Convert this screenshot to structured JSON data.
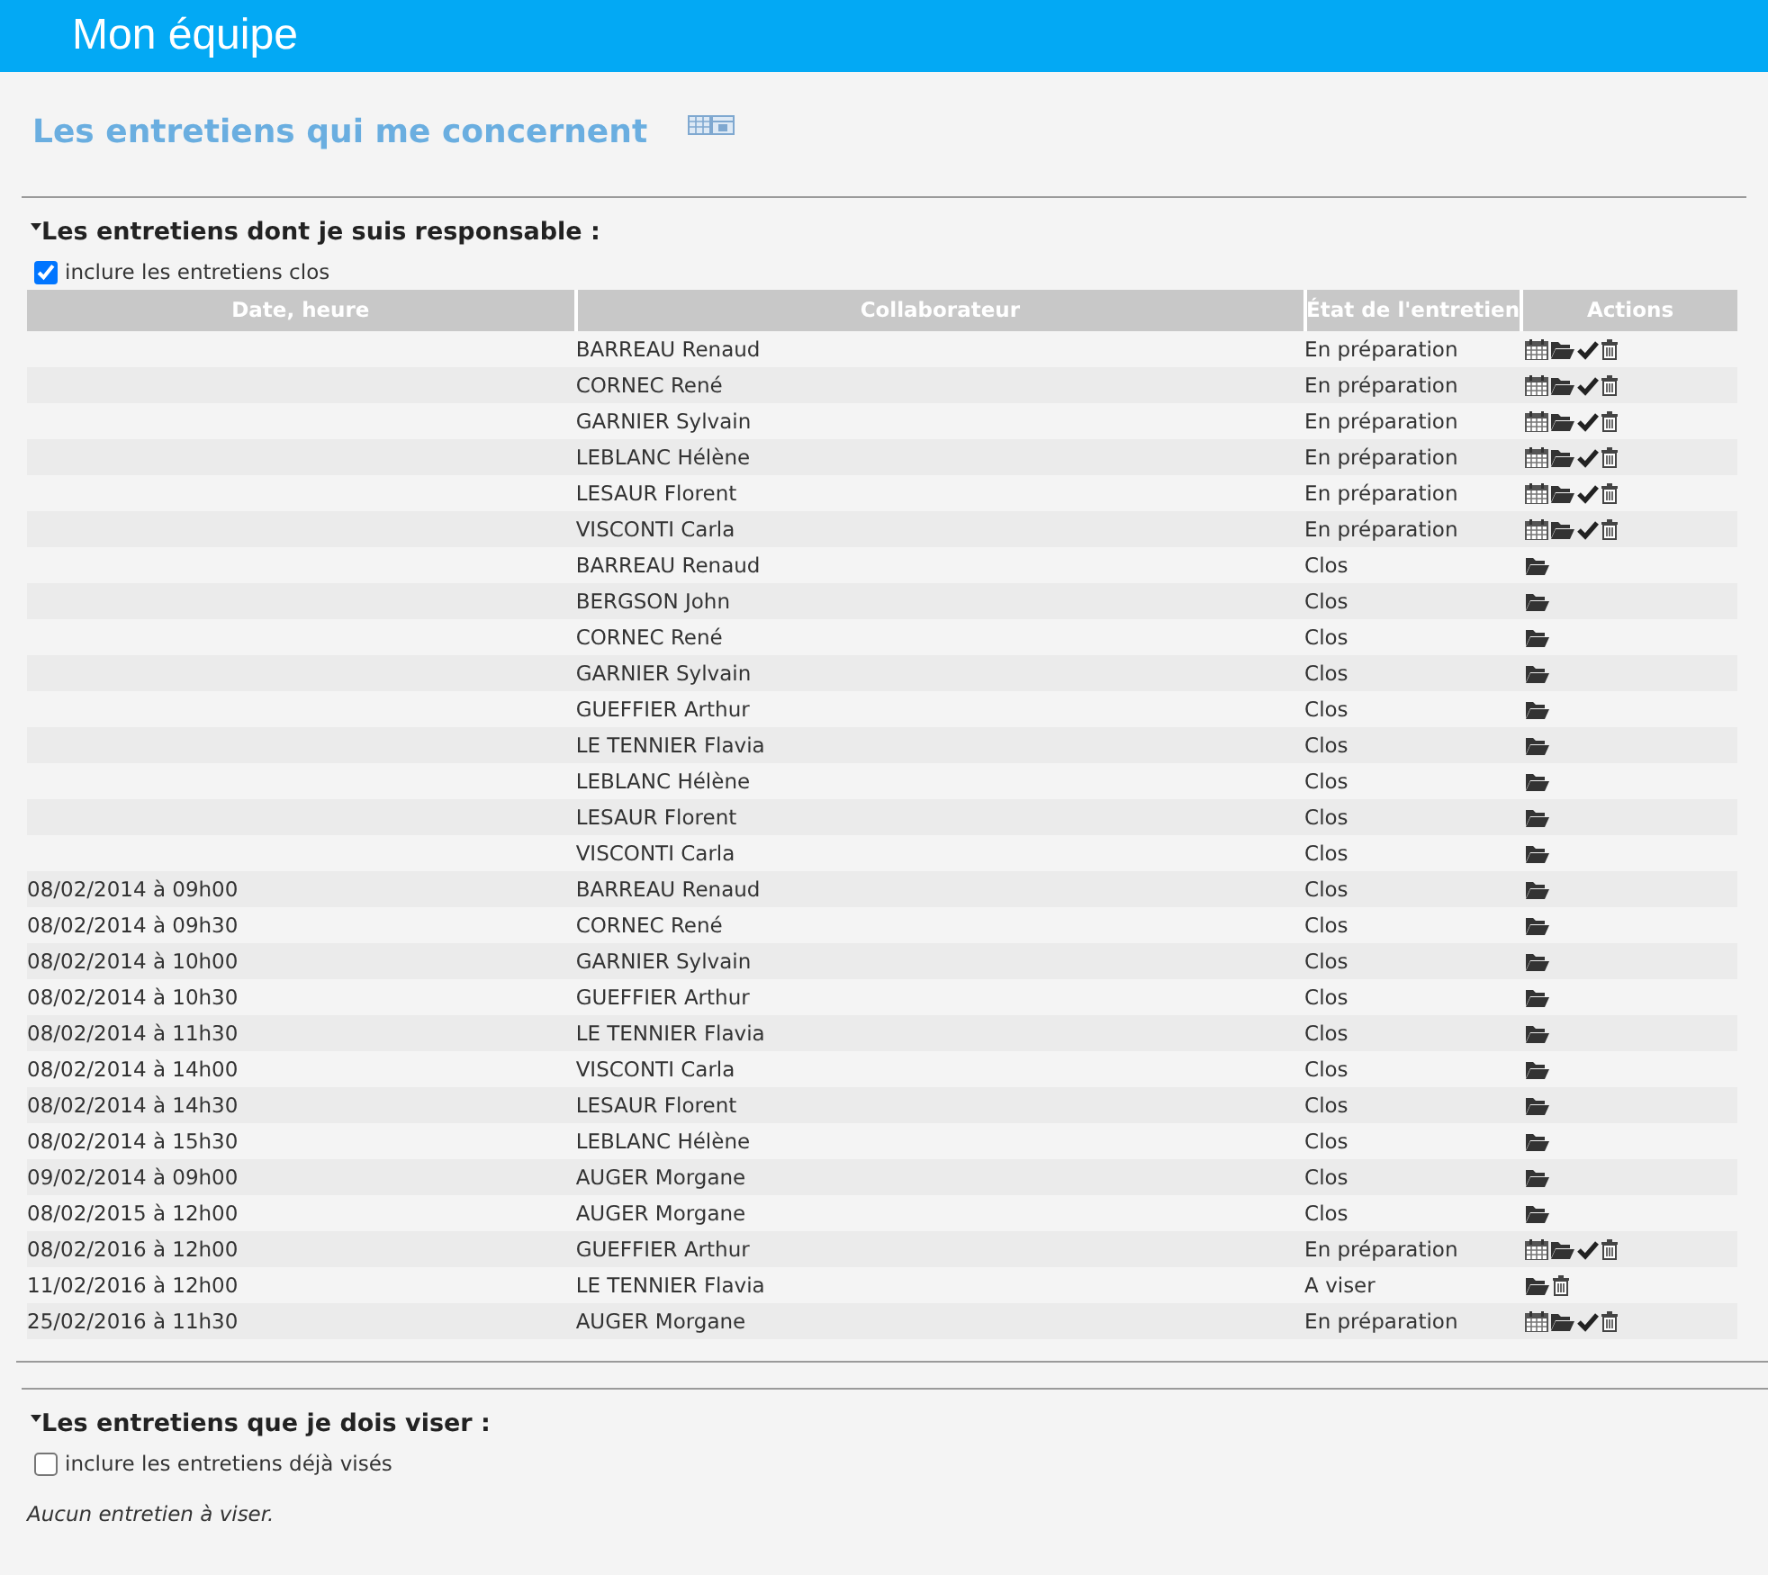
{
  "header": {
    "title": "Mon équipe"
  },
  "page_title": "Les entretiens qui me concernent",
  "sections": [
    {
      "title": "Les entretiens dont je suis responsable :",
      "expanded": true,
      "checkbox": {
        "label": "inclure les entretiens clos",
        "checked": true
      },
      "table": {
        "columns": [
          "Date, heure",
          "Collaborateur",
          "État de l'entretien",
          "Actions"
        ],
        "rows": [
          {
            "collaborateur": "BARREAU Renaud",
            "etat": "En préparation",
            "actions": [
              {
                "kind": "calendar"
              },
              {
                "kind": "folder"
              },
              {
                "kind": "check"
              },
              {
                "kind": "trash"
              }
            ]
          },
          {
            "collaborateur": "CORNEC René",
            "etat": "En préparation",
            "actions": [
              {
                "kind": "calendar"
              },
              {
                "kind": "folder"
              },
              {
                "kind": "check"
              },
              {
                "kind": "trash"
              }
            ]
          },
          {
            "collaborateur": "GARNIER Sylvain",
            "etat": "En préparation",
            "actions": [
              {
                "kind": "calendar"
              },
              {
                "kind": "folder"
              },
              {
                "kind": "check"
              },
              {
                "kind": "trash"
              }
            ]
          },
          {
            "collaborateur": "LEBLANC Hélène",
            "etat": "En préparation",
            "actions": [
              {
                "kind": "calendar"
              },
              {
                "kind": "folder"
              },
              {
                "kind": "check"
              },
              {
                "kind": "trash"
              }
            ]
          },
          {
            "collaborateur": "LESAUR Florent",
            "etat": "En préparation",
            "actions": [
              {
                "kind": "calendar"
              },
              {
                "kind": "folder"
              },
              {
                "kind": "check"
              },
              {
                "kind": "trash"
              }
            ]
          },
          {
            "collaborateur": "VISCONTI Carla",
            "etat": "En préparation",
            "actions": [
              {
                "kind": "calendar"
              },
              {
                "kind": "folder"
              },
              {
                "kind": "check"
              },
              {
                "kind": "trash"
              }
            ]
          },
          {
            "collaborateur": "BARREAU Renaud",
            "etat": "Clos",
            "actions": [
              {
                "kind": "folder"
              }
            ]
          },
          {
            "collaborateur": "BERGSON John",
            "etat": "Clos",
            "actions": [
              {
                "kind": "folder"
              }
            ]
          },
          {
            "collaborateur": "CORNEC René",
            "etat": "Clos",
            "actions": [
              {
                "kind": "folder"
              }
            ]
          },
          {
            "collaborateur": "GARNIER Sylvain",
            "etat": "Clos",
            "actions": [
              {
                "kind": "folder"
              }
            ]
          },
          {
            "collaborateur": "GUEFFIER Arthur",
            "etat": "Clos",
            "actions": [
              {
                "kind": "folder"
              }
            ]
          },
          {
            "collaborateur": "LE TENNIER Flavia",
            "etat": "Clos",
            "actions": [
              {
                "kind": "folder"
              }
            ]
          },
          {
            "collaborateur": "LEBLANC Hélène",
            "etat": "Clos",
            "actions": [
              {
                "kind": "folder"
              }
            ]
          },
          {
            "collaborateur": "LESAUR Florent",
            "etat": "Clos",
            "actions": [
              {
                "kind": "folder"
              }
            ]
          },
          {
            "collaborateur": "VISCONTI Carla",
            "etat": "Clos",
            "actions": [
              {
                "kind": "folder"
              }
            ]
          },
          {
            "date": "08/02/2014 à 09h00",
            "collaborateur": "BARREAU Renaud",
            "etat": "Clos",
            "actions": [
              {
                "kind": "folder"
              }
            ]
          },
          {
            "date": "08/02/2014 à 09h30",
            "collaborateur": "CORNEC René",
            "etat": "Clos",
            "actions": [
              {
                "kind": "folder"
              }
            ]
          },
          {
            "date": "08/02/2014 à 10h00",
            "collaborateur": "GARNIER Sylvain",
            "etat": "Clos",
            "actions": [
              {
                "kind": "folder"
              }
            ]
          },
          {
            "date": "08/02/2014 à 10h30",
            "collaborateur": "GUEFFIER Arthur",
            "etat": "Clos",
            "actions": [
              {
                "kind": "folder"
              }
            ]
          },
          {
            "date": "08/02/2014 à 11h30",
            "collaborateur": "LE TENNIER Flavia",
            "etat": "Clos",
            "actions": [
              {
                "kind": "folder"
              }
            ]
          },
          {
            "date": "08/02/2014 à 14h00",
            "collaborateur": "VISCONTI Carla",
            "etat": "Clos",
            "actions": [
              {
                "kind": "folder"
              }
            ]
          },
          {
            "date": "08/02/2014 à 14h30",
            "collaborateur": "LESAUR Florent",
            "etat": "Clos",
            "actions": [
              {
                "kind": "folder"
              }
            ]
          },
          {
            "date": "08/02/2014 à 15h30",
            "collaborateur": "LEBLANC Hélène",
            "etat": "Clos",
            "actions": [
              {
                "kind": "folder"
              }
            ]
          },
          {
            "date": "09/02/2014 à 09h00",
            "collaborateur": "AUGER Morgane",
            "etat": "Clos",
            "actions": [
              {
                "kind": "folder"
              }
            ]
          },
          {
            "date": "08/02/2015 à 12h00",
            "collaborateur": "AUGER Morgane",
            "etat": "Clos",
            "actions": [
              {
                "kind": "folder"
              }
            ]
          },
          {
            "date": "08/02/2016 à 12h00",
            "collaborateur": "GUEFFIER Arthur",
            "etat": "En préparation",
            "actions": [
              {
                "kind": "calendar"
              },
              {
                "kind": "folder"
              },
              {
                "kind": "check"
              },
              {
                "kind": "trash"
              }
            ]
          },
          {
            "date": "11/02/2016 à 12h00",
            "collaborateur": "LE TENNIER Flavia",
            "etat": "A viser",
            "actions": [
              {
                "kind": "folder"
              },
              {
                "kind": "trash"
              }
            ]
          },
          {
            "date": "25/02/2016 à 11h30",
            "collaborateur": "AUGER Morgane",
            "etat": "En préparation",
            "actions": [
              {
                "kind": "calendar"
              },
              {
                "kind": "folder"
              },
              {
                "kind": "check"
              },
              {
                "kind": "trash"
              }
            ]
          }
        ]
      }
    },
    {
      "title": "Les entretiens que je dois viser :",
      "expanded": true,
      "checkbox": {
        "label": "inclure les entretiens déjà visés",
        "checked": false
      },
      "empty_message": "Aucun entretien à viser."
    }
  ]
}
